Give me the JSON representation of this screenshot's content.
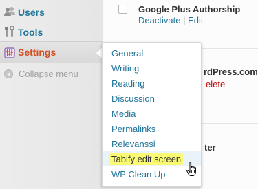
{
  "sidebar": {
    "items": [
      {
        "label": "Users",
        "icon": "users-icon"
      },
      {
        "label": "Tools",
        "icon": "tools-icon"
      },
      {
        "label": "Settings",
        "icon": "settings-icon",
        "active": true
      }
    ],
    "collapse_label": "Collapse menu"
  },
  "plugins": {
    "row1": {
      "name": "Google Plus Authorship",
      "actions": [
        "Deactivate",
        "Edit"
      ],
      "separator": "|"
    },
    "row2_partial_name": "rdPress.com",
    "row2_partial_action": "elete",
    "row3_partial_name": "ter"
  },
  "settings_submenu": {
    "items": [
      "General",
      "Writing",
      "Reading",
      "Discussion",
      "Media",
      "Permalinks",
      "Relevanssi",
      "Tabify edit screen",
      "WP Clean Up"
    ],
    "hovered_index": 7
  },
  "colors": {
    "link": "#21759b",
    "active_menu": "#d54e21",
    "delete": "#bc0b0b",
    "highlight": "#fafa73"
  }
}
